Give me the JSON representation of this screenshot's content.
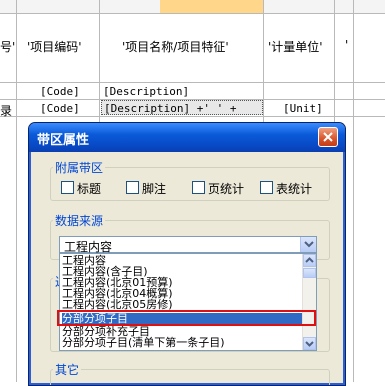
{
  "sheet": {
    "headers": {
      "col0_fragment": "号'",
      "col1": "'项目编码'",
      "col2": "'项目名称/项目特征'",
      "col3": "'计量单位'",
      "col4_fragment": "'"
    },
    "row1": {
      "code": "[Code]",
      "desc": "[Description]"
    },
    "row2": {
      "col0_fragment": "录",
      "code": "[Code]",
      "desc": "[Description] +' ' +",
      "unit": "[Unit]"
    }
  },
  "dialog": {
    "title": "带区属性",
    "close_icon": "close-x-icon",
    "title_color": "#ffffff",
    "attached_band": {
      "group_label": "附属带区",
      "options": [
        {
          "label": "标题",
          "checked": false
        },
        {
          "label": "脚注",
          "checked": false
        },
        {
          "label": "页统计",
          "checked": false
        },
        {
          "label": "表统计",
          "checked": false
        }
      ]
    },
    "data_source": {
      "group_label": "数据来源",
      "selected_value": "工程内容",
      "hidden_group_label_fragment": "过",
      "options": [
        "工程内容",
        "工程内容(含子目)",
        "工程内容(北京01预算)",
        "工程内容(北京04概算)",
        "工程内容(北京05房修)",
        "分部分项子目",
        "分部分项补充子目",
        "分部分项子目(清单下第一条子目)"
      ],
      "highlighted_option": "分部分项子目",
      "highlight_color": "#316ac5",
      "annotation_color": "#e01010"
    },
    "other": {
      "group_label": "其它"
    }
  }
}
